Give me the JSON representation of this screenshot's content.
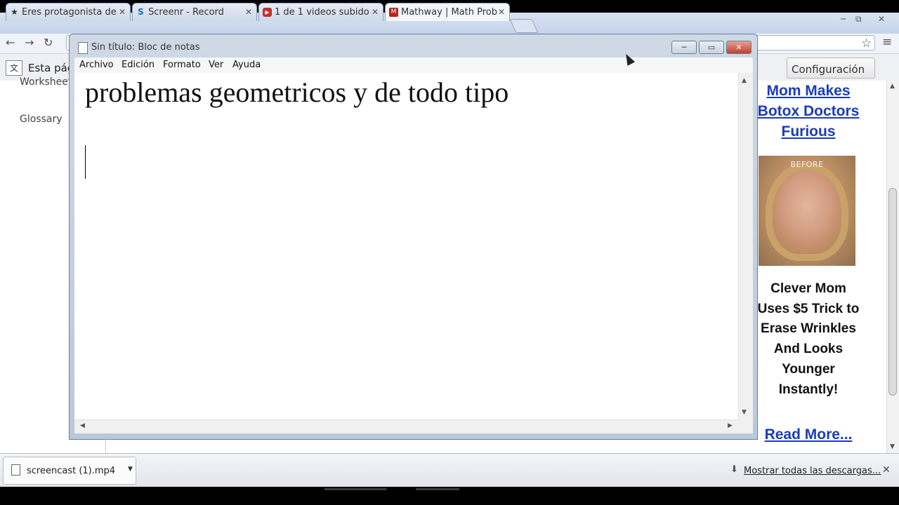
{
  "browser": {
    "tabs": [
      {
        "label": "Eres protagonista de",
        "icon": "star-icon",
        "active": false
      },
      {
        "label": "Screenr - Record",
        "icon": "screenr-icon",
        "active": false
      },
      {
        "label": "1 de 1 videos subido",
        "icon": "youtube-icon",
        "active": false
      },
      {
        "label": "Mathway | Math Prob",
        "icon": "mathway-icon",
        "active": true
      }
    ],
    "window_controls": {
      "minimize": "─",
      "restore": "⧉",
      "close": "✕"
    }
  },
  "translate_bar": {
    "text": "Esta pág",
    "config_label": "Configuración"
  },
  "page": {
    "sidebar": {
      "worksheets": "Worksheets",
      "glossary": "Glossary"
    },
    "ad": {
      "headline": "Mom Makes Botox Doctors Furious",
      "image_label": "BEFORE",
      "body": "Clever Mom Uses $5 Trick to Erase Wrinkles And Looks Younger Instantly!",
      "read_more": "Read More..."
    }
  },
  "notepad": {
    "title": "Sin título: Bloc de notas",
    "menu": [
      "Archivo",
      "Edición",
      "Formato",
      "Ver",
      "Ayuda"
    ],
    "content": "problemas geometricos y de todo tipo",
    "controls": {
      "minimize": "─",
      "maximize": "▭",
      "close": "✕"
    }
  },
  "downloads": {
    "file_name": "screencast (1).mp4",
    "show_all": "Mostrar todas las descargas..."
  }
}
